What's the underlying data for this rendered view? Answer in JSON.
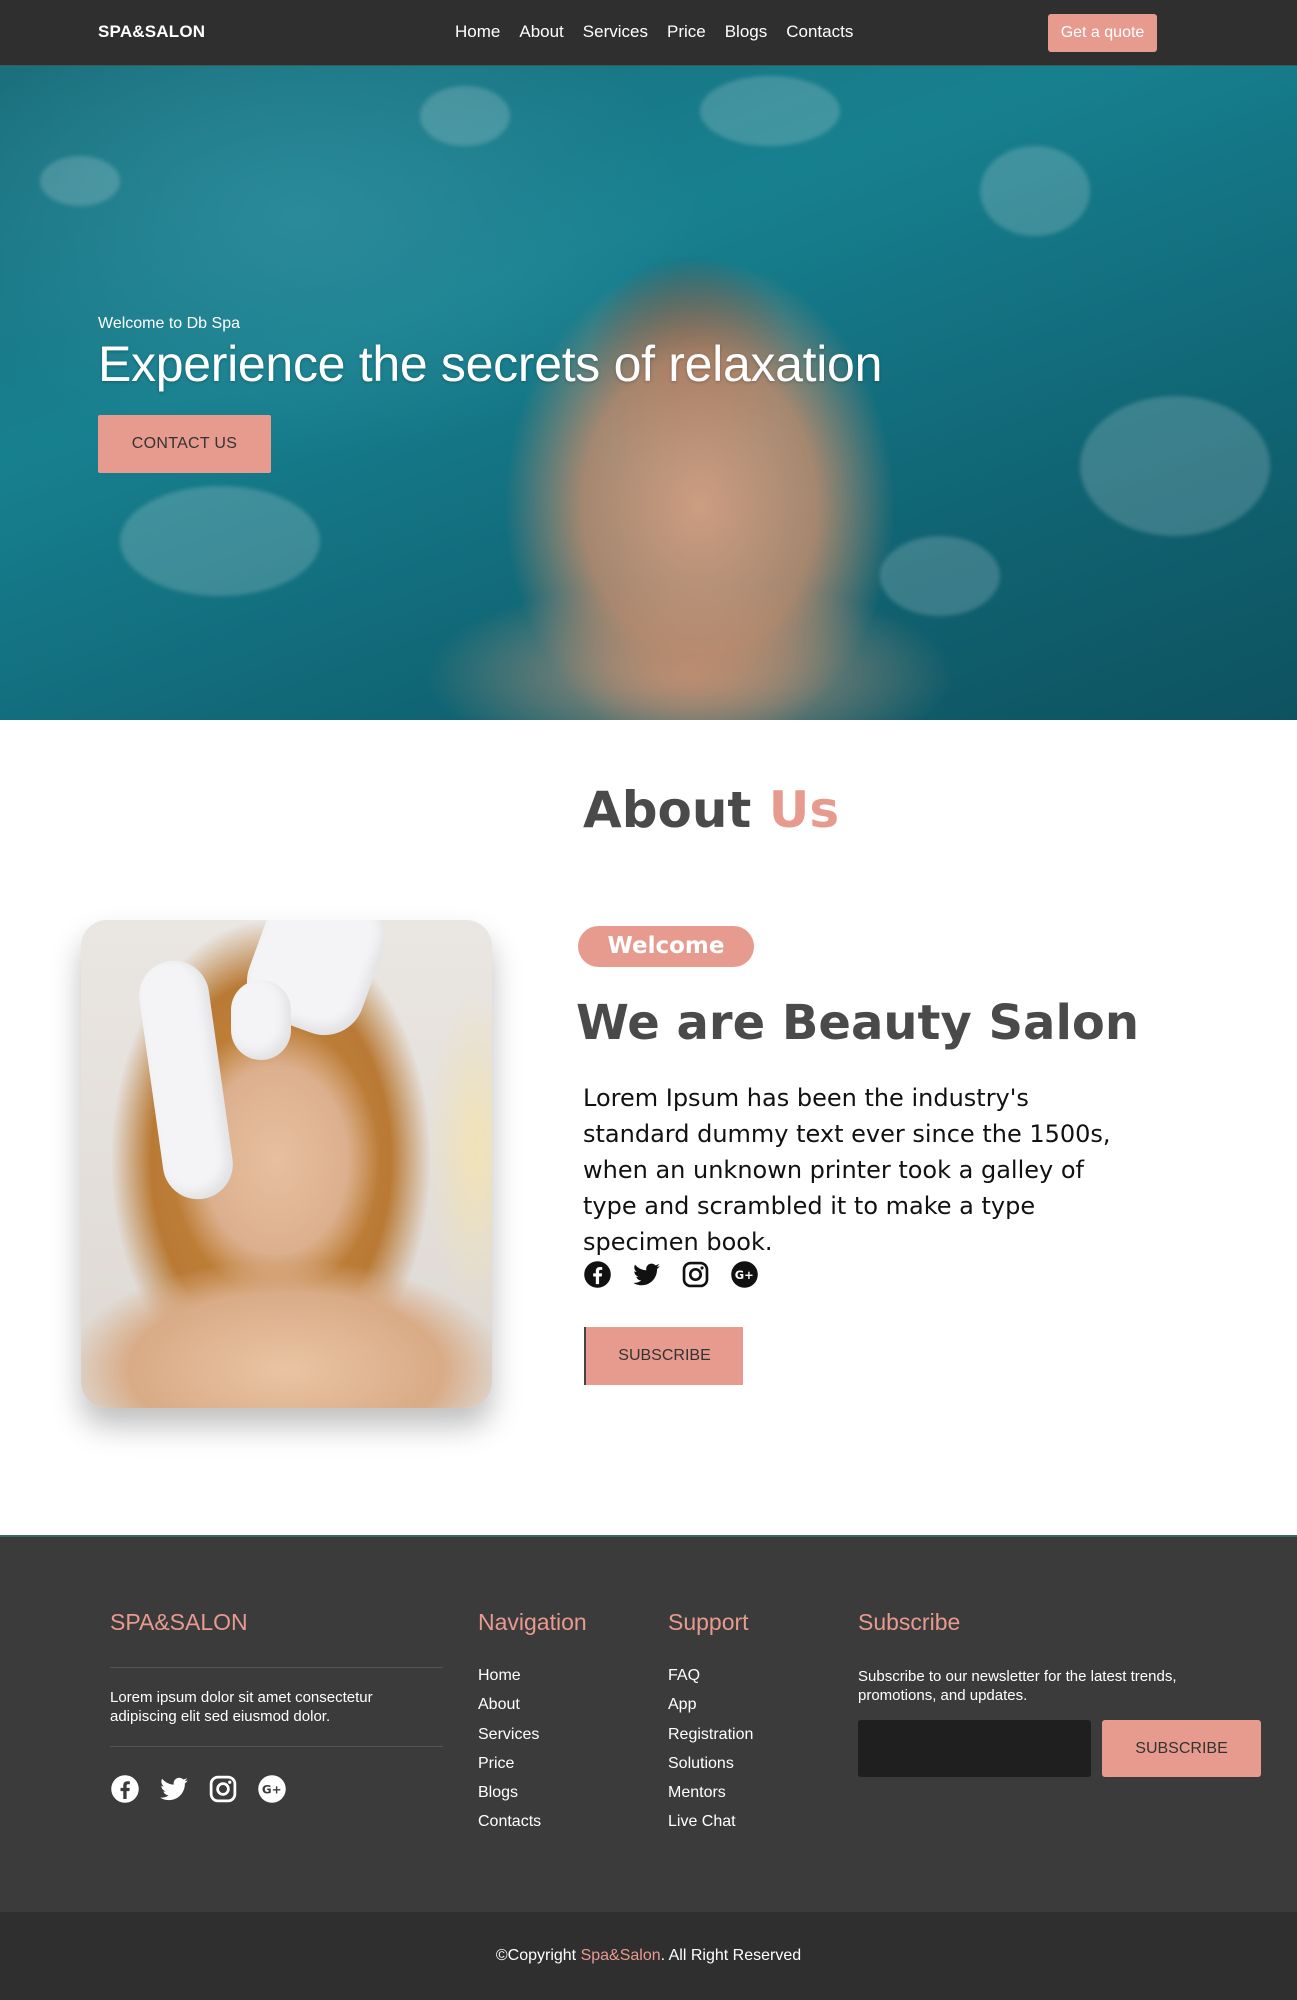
{
  "nav": {
    "brand": "SPA&SALON",
    "links": [
      "Home",
      "About",
      "Services",
      "Price",
      "Blogs",
      "Contacts"
    ],
    "cta": "Get a quote"
  },
  "hero": {
    "eyebrow": "Welcome to Db Spa",
    "title": "Experience the secrets of relaxation",
    "button": "CONTACT US"
  },
  "about": {
    "heading_main": "About",
    "heading_accent": "Us",
    "pill": "Welcome",
    "title": "We are Beauty Salon",
    "body": "Lorem Ipsum has been the industry's standard dummy text ever since the 1500s, when an unknown printer took a galley of type and scrambled it to make a type specimen book.",
    "social_icons": [
      "facebook-icon",
      "twitter-icon",
      "instagram-icon",
      "google-plus-icon"
    ],
    "button": "SUBSCRIBE"
  },
  "footer": {
    "brand": "SPA&SALON",
    "description": "Lorem ipsum dolor sit amet consectetur adipiscing elit sed eiusmod dolor.",
    "social_icons": [
      "facebook-icon",
      "twitter-icon",
      "instagram-icon",
      "google-plus-icon"
    ],
    "navigation": {
      "title": "Navigation",
      "items": [
        "Home",
        "About",
        "Services",
        "Price",
        "Blogs",
        "Contacts"
      ]
    },
    "support": {
      "title": "Support",
      "items": [
        "FAQ",
        "App",
        "Registration",
        "Solutions",
        "Mentors",
        "Live Chat"
      ]
    },
    "subscribe": {
      "title": "Subscribe",
      "text": "Subscribe to our newsletter for the latest trends, promotions, and updates.",
      "input_value": "",
      "button": "SUBSCRIBE"
    }
  },
  "copyright": {
    "prefix": "©Copyright ",
    "brand": "Spa&Salon",
    "suffix": ". All Right Reserved"
  },
  "colors": {
    "accent": "#e79b8f",
    "dark": "#2f2f2f",
    "footer": "#3b3b3b",
    "heading": "#4a4a4a"
  }
}
